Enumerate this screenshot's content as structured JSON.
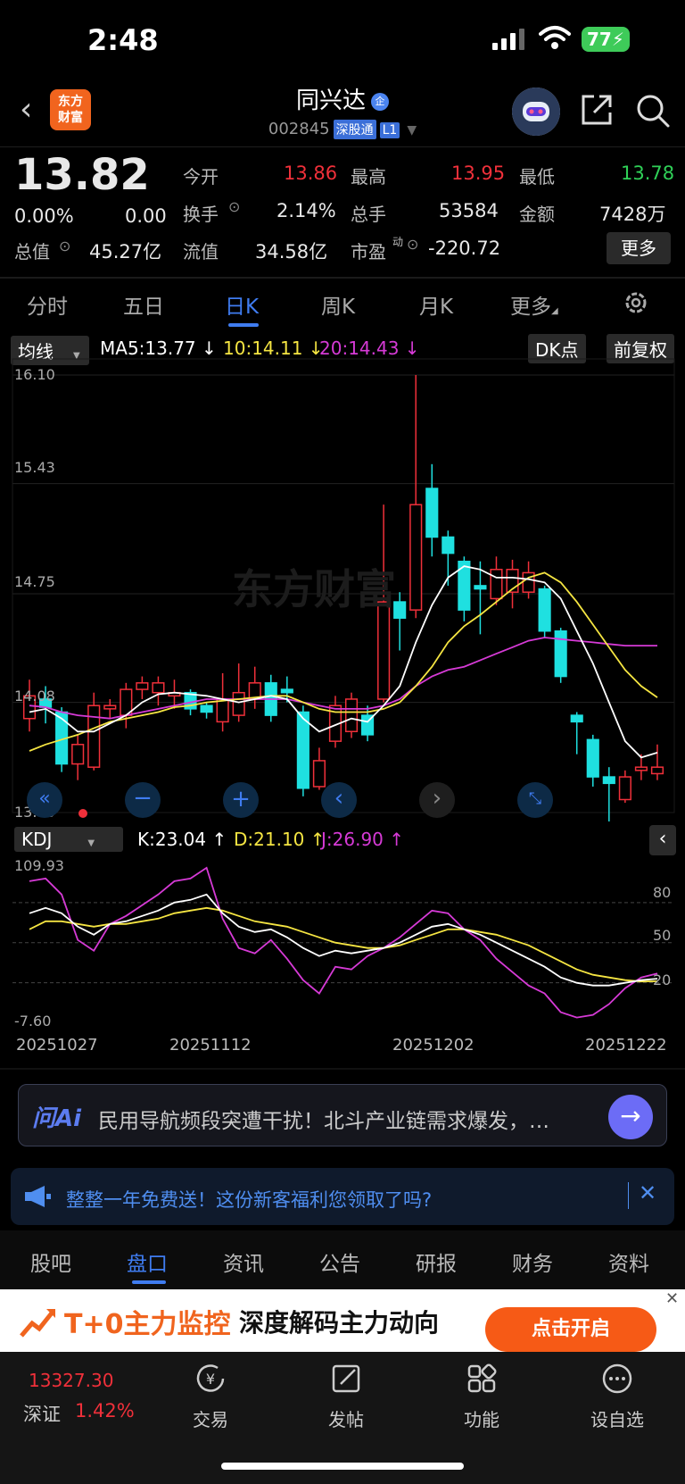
{
  "status": {
    "time": "2:48",
    "battery": "77"
  },
  "header": {
    "logo_line1": "东方",
    "logo_line2": "财富",
    "stock_name": "同兴达",
    "badge": "企",
    "code": "002845",
    "connect_tag": "深股通",
    "level_tag": "L1"
  },
  "quote": {
    "price": "13.82",
    "change_pct": "0.00%",
    "change": "0.00",
    "open_label": "今开",
    "open": "13.86",
    "high_label": "最高",
    "high": "13.95",
    "low_label": "最低",
    "low": "13.78",
    "turnover_label": "换手",
    "turnover": "2.14%",
    "volume_label": "总手",
    "volume": "53584",
    "amount_label": "金额",
    "amount": "7428万",
    "mktcap_label": "总值",
    "mktcap": "45.27亿",
    "float_label": "流值",
    "float": "34.58亿",
    "pe_label": "市盈",
    "pe_sup": "动",
    "pe": "-220.72",
    "more": "更多"
  },
  "tabs": [
    "分时",
    "五日",
    "日K",
    "周K",
    "月K",
    "更多"
  ],
  "active_tab": "日K",
  "ma_bar": {
    "dropdown": "均线",
    "ma5": "MA5:13.77",
    "ma10": "10:14.11",
    "ma20": "20:14.43",
    "dk": "DK点",
    "adjust": "前复权"
  },
  "kline_axis": {
    "y_top": "16.10",
    "y2": "15.43",
    "y3": "14.75",
    "y4": "14.08",
    "y_bottom": "13.40"
  },
  "kdj_bar": {
    "dropdown": "KDJ",
    "k": "K:23.04",
    "d": "D:21.10",
    "j": "J:26.90"
  },
  "kdj_axis": {
    "top": "109.93",
    "bottom": "-7.60",
    "l80": "80",
    "l50": "50",
    "l20": "20"
  },
  "dates": [
    "20251027",
    "20251112",
    "20251202",
    "20251222"
  ],
  "watermark": "东方财富",
  "ai": {
    "logo": "问Ai",
    "text": "民用导航频段突遭干扰！北斗产业链需求爆发，…"
  },
  "notice": {
    "text": "整整一年免费送！这份新客福利您领取了吗?"
  },
  "bottom_tabs": [
    "股吧",
    "盘口",
    "资讯",
    "公告",
    "研报",
    "财务",
    "资料"
  ],
  "active_bottom_tab": "盘口",
  "banner": {
    "t0": "T+0主力监控",
    "t1": "深度解码主力动向",
    "button": "点击开启"
  },
  "nav": {
    "index_value": "13327.30",
    "index_name": "深证",
    "index_change": "1.42%",
    "items": [
      "交易",
      "发帖",
      "功能",
      "设自选"
    ]
  },
  "colors": {
    "up": "#f0303a",
    "down": "#1fe0e0",
    "ma5": "#ffffff",
    "ma10": "#f5e542",
    "ma20": "#d63ad6",
    "accent": "#3f7cf0"
  },
  "chart_data": {
    "type": "candlestick",
    "title": "",
    "ylim": [
      13.4,
      16.1
    ],
    "candles": [
      {
        "o": 13.98,
        "c": 14.12,
        "h": 14.22,
        "l": 13.9
      },
      {
        "o": 14.1,
        "c": 14.05,
        "h": 14.18,
        "l": 13.95
      },
      {
        "o": 14.02,
        "c": 13.7,
        "h": 14.05,
        "l": 13.65
      },
      {
        "o": 13.7,
        "c": 13.82,
        "h": 13.88,
        "l": 13.6
      },
      {
        "o": 13.68,
        "c": 14.06,
        "h": 14.14,
        "l": 13.66
      },
      {
        "o": 14.04,
        "c": 14.06,
        "h": 14.1,
        "l": 13.98
      },
      {
        "o": 14.0,
        "c": 14.16,
        "h": 14.2,
        "l": 13.92
      },
      {
        "o": 14.16,
        "c": 14.2,
        "h": 14.24,
        "l": 14.1
      },
      {
        "o": 14.14,
        "c": 14.2,
        "h": 14.24,
        "l": 14.06
      },
      {
        "o": 14.12,
        "c": 14.14,
        "h": 14.22,
        "l": 14.04
      },
      {
        "o": 14.14,
        "c": 14.04,
        "h": 14.16,
        "l": 14.0
      },
      {
        "o": 14.06,
        "c": 14.02,
        "h": 14.08,
        "l": 13.98
      },
      {
        "o": 13.96,
        "c": 14.1,
        "h": 14.26,
        "l": 13.9
      },
      {
        "o": 14.0,
        "c": 14.14,
        "h": 14.32,
        "l": 13.96
      },
      {
        "o": 14.1,
        "c": 14.2,
        "h": 14.3,
        "l": 14.04
      },
      {
        "o": 14.2,
        "c": 14.0,
        "h": 14.25,
        "l": 13.96
      },
      {
        "o": 14.16,
        "c": 14.14,
        "h": 14.24,
        "l": 14.08
      },
      {
        "o": 14.02,
        "c": 13.55,
        "h": 14.06,
        "l": 13.5
      },
      {
        "o": 13.56,
        "c": 13.72,
        "h": 13.8,
        "l": 13.54
      },
      {
        "o": 13.84,
        "c": 14.06,
        "h": 14.12,
        "l": 13.8
      },
      {
        "o": 13.9,
        "c": 14.1,
        "h": 14.14,
        "l": 13.86
      },
      {
        "o": 14.0,
        "c": 13.88,
        "h": 14.06,
        "l": 13.84
      },
      {
        "o": 14.1,
        "c": 14.7,
        "h": 15.3,
        "l": 14.08
      },
      {
        "o": 14.7,
        "c": 14.6,
        "h": 14.76,
        "l": 14.4
      },
      {
        "o": 14.65,
        "c": 15.3,
        "h": 16.1,
        "l": 14.6
      },
      {
        "o": 15.4,
        "c": 15.1,
        "h": 15.55,
        "l": 14.98
      },
      {
        "o": 15.1,
        "c": 15.0,
        "h": 15.14,
        "l": 14.8
      },
      {
        "o": 14.95,
        "c": 14.65,
        "h": 14.98,
        "l": 14.58
      },
      {
        "o": 14.8,
        "c": 14.78,
        "h": 14.95,
        "l": 14.5
      },
      {
        "o": 14.72,
        "c": 14.9,
        "h": 14.98,
        "l": 14.68
      },
      {
        "o": 14.76,
        "c": 14.9,
        "h": 14.96,
        "l": 14.66
      },
      {
        "o": 14.76,
        "c": 14.88,
        "h": 14.95,
        "l": 14.72
      },
      {
        "o": 14.78,
        "c": 14.52,
        "h": 14.8,
        "l": 14.48
      },
      {
        "o": 14.52,
        "c": 14.24,
        "h": 14.54,
        "l": 14.2
      },
      {
        "o": 14.0,
        "c": 13.96,
        "h": 14.02,
        "l": 13.76
      },
      {
        "o": 13.85,
        "c": 13.62,
        "h": 13.88,
        "l": 13.56
      },
      {
        "o": 13.62,
        "c": 13.58,
        "h": 13.68,
        "l": 13.34
      },
      {
        "o": 13.48,
        "c": 13.62,
        "h": 13.66,
        "l": 13.46
      },
      {
        "o": 13.66,
        "c": 13.68,
        "h": 13.76,
        "l": 13.6
      },
      {
        "o": 13.64,
        "c": 13.68,
        "h": 13.82,
        "l": 13.6
      }
    ],
    "ma5": [
      14.02,
      14.04,
      13.98,
      13.9,
      13.9,
      13.95,
      14.0,
      14.08,
      14.13,
      14.14,
      14.13,
      14.12,
      14.1,
      14.08,
      14.1,
      14.12,
      14.1,
      13.98,
      13.9,
      13.94,
      13.98,
      13.96,
      14.06,
      14.18,
      14.45,
      14.68,
      14.85,
      14.92,
      14.9,
      14.85,
      14.85,
      14.84,
      14.82,
      14.72,
      14.52,
      14.32,
      14.08,
      13.84,
      13.74,
      13.77
    ],
    "ma10": [
      13.78,
      13.82,
      13.85,
      13.88,
      13.92,
      13.96,
      13.98,
      14.0,
      14.02,
      14.05,
      14.06,
      14.08,
      14.09,
      14.1,
      14.11,
      14.12,
      14.12,
      14.08,
      14.04,
      14.02,
      14.02,
      14.02,
      14.04,
      14.08,
      14.18,
      14.3,
      14.45,
      14.55,
      14.62,
      14.7,
      14.78,
      14.85,
      14.88,
      14.82,
      14.7,
      14.56,
      14.42,
      14.28,
      14.18,
      14.11
    ],
    "ma20": [
      14.06,
      14.05,
      14.02,
      14.0,
      13.99,
      13.98,
      14.0,
      14.02,
      14.04,
      14.06,
      14.08,
      14.1,
      14.1,
      14.1,
      14.1,
      14.1,
      14.1,
      14.08,
      14.06,
      14.04,
      14.04,
      14.04,
      14.06,
      14.1,
      14.18,
      14.24,
      14.28,
      14.3,
      14.34,
      14.38,
      14.42,
      14.46,
      14.48,
      14.47,
      14.46,
      14.45,
      14.44,
      14.43,
      14.43,
      14.43
    ],
    "kdj": {
      "ylim": [
        -7.6,
        109.93
      ],
      "k": [
        72,
        76,
        72,
        62,
        56,
        64,
        66,
        70,
        74,
        80,
        82,
        86,
        72,
        62,
        58,
        60,
        54,
        46,
        40,
        44,
        42,
        44,
        46,
        50,
        56,
        62,
        64,
        60,
        56,
        50,
        44,
        38,
        32,
        24,
        20,
        18,
        18,
        20,
        22,
        23.04
      ],
      "d": [
        60,
        66,
        66,
        64,
        62,
        64,
        64,
        66,
        68,
        72,
        74,
        76,
        74,
        70,
        66,
        64,
        62,
        58,
        54,
        50,
        48,
        46,
        46,
        48,
        52,
        56,
        60,
        60,
        58,
        56,
        52,
        48,
        42,
        36,
        30,
        26,
        24,
        22,
        21,
        21.1
      ],
      "j": [
        96,
        98,
        86,
        52,
        44,
        64,
        70,
        78,
        86,
        96,
        98,
        106,
        68,
        46,
        42,
        52,
        38,
        22,
        12,
        32,
        30,
        40,
        46,
        54,
        64,
        74,
        72,
        60,
        52,
        38,
        28,
        18,
        12,
        -2,
        -6,
        -4,
        4,
        16,
        24,
        26.9
      ]
    }
  }
}
